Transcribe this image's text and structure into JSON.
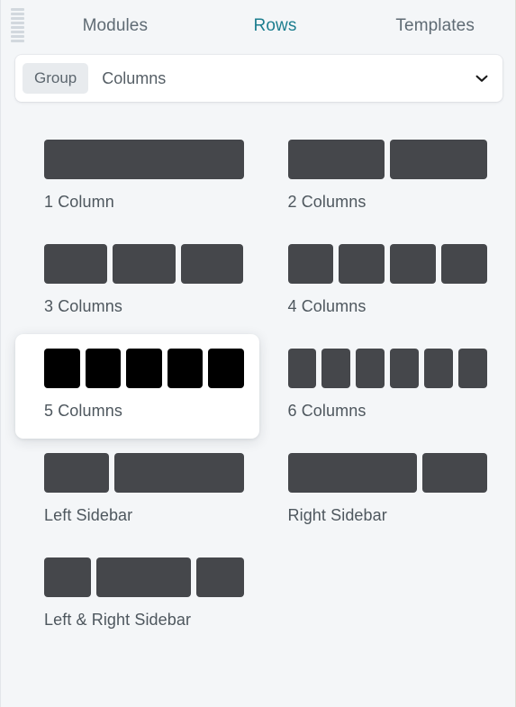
{
  "header": {
    "grip_icon": "drag-grip-icon",
    "grip_lines": 8,
    "tabs": [
      {
        "label": "Modules",
        "active": false
      },
      {
        "label": "Rows",
        "active": true
      },
      {
        "label": "Templates",
        "active": false
      }
    ],
    "active_tab_color": "#1d7e8f",
    "inactive_tab_color": "#5f6b74"
  },
  "filter": {
    "group_label": "Group",
    "value": "Columns",
    "chevron_icon": "chevron-down-icon"
  },
  "colors": {
    "background": "#f4f6f8",
    "block": "#45474b",
    "block_hovered": "#000000",
    "card_hovered": "#ffffff"
  },
  "layouts": [
    {
      "label": "1 Column",
      "weights": [
        1
      ],
      "hovered": false
    },
    {
      "label": "2 Columns",
      "weights": [
        1,
        1
      ],
      "hovered": false
    },
    {
      "label": "3 Columns",
      "weights": [
        1,
        1,
        1
      ],
      "hovered": false
    },
    {
      "label": "4 Columns",
      "weights": [
        1,
        1,
        1,
        1
      ],
      "hovered": false
    },
    {
      "label": "5 Columns",
      "weights": [
        1,
        1,
        1,
        1,
        1
      ],
      "hovered": true
    },
    {
      "label": "6 Columns",
      "weights": [
        1,
        1,
        1,
        1,
        1,
        1
      ],
      "hovered": false
    },
    {
      "label": "Left Sidebar",
      "weights": [
        1,
        2
      ],
      "hovered": false
    },
    {
      "label": "Right Sidebar",
      "weights": [
        2,
        1
      ],
      "hovered": false
    },
    {
      "label": "Left & Right Sidebar",
      "weights": [
        1,
        2,
        1
      ],
      "hovered": false
    }
  ]
}
